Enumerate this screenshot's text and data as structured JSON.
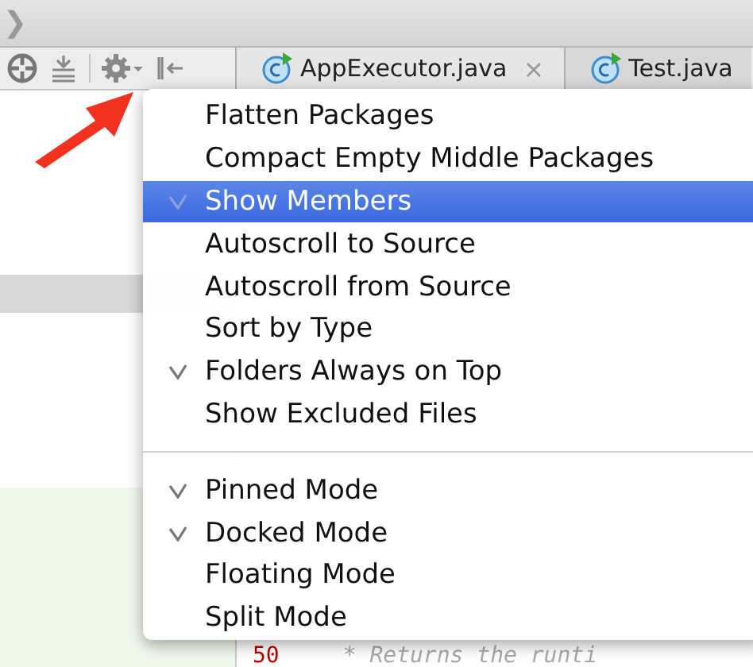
{
  "breadcrumb": {
    "separator": "❯"
  },
  "toolbar": {
    "tools": [
      {
        "kind": "locate"
      },
      {
        "kind": "collapse"
      },
      {
        "kind": "settings"
      },
      {
        "kind": "hide"
      }
    ]
  },
  "tabs": [
    {
      "label": "AppExecutor.java",
      "selected": true,
      "close": "×"
    },
    {
      "label": "Test.java",
      "selected": false
    }
  ],
  "editor": {
    "line_number": "50",
    "code": "* Returns the runti"
  },
  "menu": {
    "groups": [
      [
        {
          "label": "Flatten Packages",
          "checked": false,
          "selected": false
        },
        {
          "label": "Compact Empty Middle Packages",
          "checked": false,
          "selected": false
        },
        {
          "label": "Show Members",
          "checked": true,
          "selected": true
        },
        {
          "label": "Autoscroll to Source",
          "checked": false,
          "selected": false
        },
        {
          "label": "Autoscroll from Source",
          "checked": false,
          "selected": false
        },
        {
          "label": "Sort by Type",
          "checked": false,
          "selected": false
        },
        {
          "label": "Folders Always on Top",
          "checked": true,
          "selected": false
        },
        {
          "label": "Show Excluded Files",
          "checked": false,
          "selected": false
        }
      ],
      [
        {
          "label": "Pinned Mode",
          "checked": true,
          "selected": false
        },
        {
          "label": "Docked Mode",
          "checked": true,
          "selected": false
        },
        {
          "label": "Floating Mode",
          "checked": false,
          "selected": false
        },
        {
          "label": "Split Mode",
          "checked": false,
          "selected": false
        }
      ]
    ]
  }
}
